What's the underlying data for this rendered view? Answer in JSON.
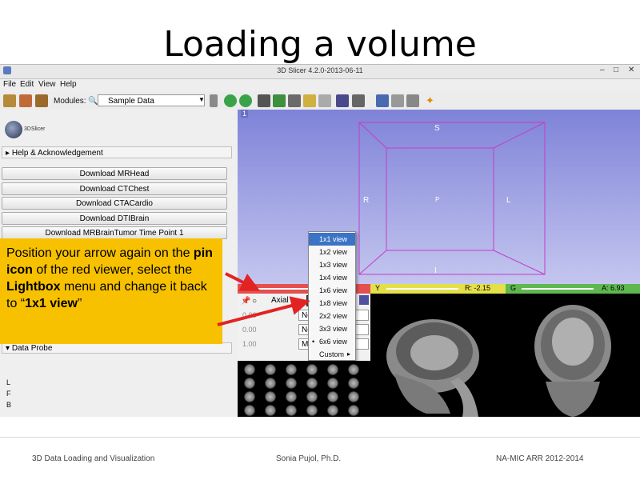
{
  "slide": {
    "title": "Loading a volume"
  },
  "window": {
    "title": "3D Slicer 4.2.0-2013-06-11"
  },
  "menu": [
    "File",
    "Edit",
    "View",
    "Help"
  ],
  "toolbar": {
    "modules_label": "Modules:",
    "module_value": "Sample Data"
  },
  "left_panel": {
    "logo_text": "3DSlicer",
    "help_header": "Help & Acknowledgement",
    "download_buttons": [
      "Download MRHead",
      "Download CTChest",
      "Download CTACardio",
      "Download DTIBrain",
      "Download MRBrainTumor Time Point 1"
    ],
    "data_probe": "Data Probe",
    "orientation": [
      "L",
      "F",
      "B"
    ]
  },
  "view3d": {
    "label_s": "S",
    "label_r": "R",
    "label_l": "L",
    "label_p": "P",
    "label_i": "I",
    "view_number": "1"
  },
  "red_slice": {
    "bar_label": "R",
    "orientation": "Axial",
    "rows": [
      {
        "opacity": "0.00",
        "value": "None"
      },
      {
        "opacity": "0.00",
        "value": "None"
      },
      {
        "opacity": "1.00",
        "value": "MRHead"
      }
    ]
  },
  "yellow_slice": {
    "bar_label": "Y",
    "readout": "R: -2.15"
  },
  "green_slice": {
    "bar_label": "G",
    "readout": "A: 6.93"
  },
  "lightbox_menu": {
    "items": [
      "1x1 view",
      "1x2 view",
      "1x3 view",
      "1x4 view",
      "1x6 view",
      "1x8 view",
      "2x2 view",
      "3x3 view",
      "6x6 view",
      "Custom"
    ],
    "highlighted": "1x1 view",
    "checked": "6x6 view"
  },
  "callout": {
    "text_1": "Position your arrow again on the ",
    "bold_1": "pin icon",
    "text_2": " of the red viewer, select the ",
    "bold_2": "Lightbox",
    "text_3": " menu and change it back to “",
    "bold_3": "1x1 view",
    "text_4": "”"
  },
  "footer": {
    "left": "3D Data Loading and Visualization",
    "center": "Sonia Pujol, Ph.D.",
    "right": "NA-MIC ARR 2012-2014"
  },
  "colors": {
    "callout": "#f7c100",
    "red_bar": "#e45050",
    "yellow_bar": "#e4e04a",
    "green_bar": "#5fb84f",
    "box_3d": "#c43cc8"
  }
}
